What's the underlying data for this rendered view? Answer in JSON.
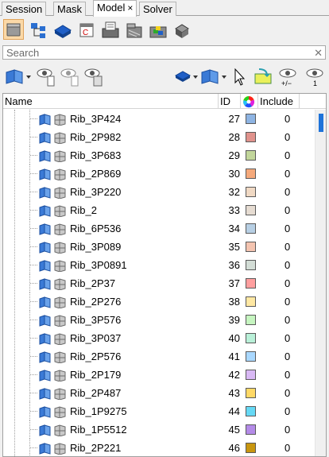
{
  "tabs": [
    {
      "label": "Session",
      "active": false
    },
    {
      "label": "Mask",
      "active": false
    },
    {
      "label": "Model",
      "active": true,
      "close": "×"
    },
    {
      "label": "Solver",
      "active": false
    }
  ],
  "toolbar1": {
    "icons": [
      "component-view-icon",
      "hierarchy-view-icon",
      "part-assembly-icon",
      "calendar-reset-icon",
      "include-file-icon",
      "material-icon",
      "property-icon",
      "solid-blocks-icon",
      "connector-icon"
    ]
  },
  "search": {
    "placeholder": "Search",
    "value": ""
  },
  "toolbar2": {
    "icons": [
      "entity-display-icon",
      "dropdown-arrow-icon",
      "show-icon",
      "hide-icon",
      "isolate-icon",
      "component-color-icon",
      "part-visibility-icon",
      "pointer-icon",
      "export-icon",
      "reverse-visibility-icon",
      "show-one-icon"
    ]
  },
  "table": {
    "columns": {
      "name": "Name",
      "id": "ID",
      "include": "Include"
    },
    "rows": [
      {
        "name": "Rib_3P424",
        "id": "27",
        "color": "#8eb4e3",
        "include": "0"
      },
      {
        "name": "Rib_2P982",
        "id": "28",
        "color": "#e0928c",
        "include": "0"
      },
      {
        "name": "Rib_3P683",
        "id": "29",
        "color": "#c2d69b",
        "include": "0"
      },
      {
        "name": "Rib_2P869",
        "id": "30",
        "color": "#f5a97b",
        "include": "0"
      },
      {
        "name": "Rib_3P220",
        "id": "32",
        "color": "#f0d9c4",
        "include": "0"
      },
      {
        "name": "Rib_2",
        "id": "33",
        "color": "#e6dcd2",
        "include": "0"
      },
      {
        "name": "Rib_6P536",
        "id": "34",
        "color": "#b7cfe4",
        "include": "0"
      },
      {
        "name": "Rib_3P089",
        "id": "35",
        "color": "#f4c4b0",
        "include": "0"
      },
      {
        "name": "Rib_3P0891",
        "id": "36",
        "color": "#d3ddd6",
        "include": "0"
      },
      {
        "name": "Rib_2P37",
        "id": "37",
        "color": "#ff9f9f",
        "include": "0"
      },
      {
        "name": "Rib_2P276",
        "id": "38",
        "color": "#ffe8a3",
        "include": "0"
      },
      {
        "name": "Rib_3P576",
        "id": "39",
        "color": "#c6f5c0",
        "include": "0"
      },
      {
        "name": "Rib_3P037",
        "id": "40",
        "color": "#b9f0d8",
        "include": "0"
      },
      {
        "name": "Rib_2P576",
        "id": "41",
        "color": "#a9d8ff",
        "include": "0"
      },
      {
        "name": "Rib_2P179",
        "id": "42",
        "color": "#d9b9f5",
        "include": "0"
      },
      {
        "name": "Rib_2P487",
        "id": "43",
        "color": "#ffd966",
        "include": "0"
      },
      {
        "name": "Rib_1P9275",
        "id": "44",
        "color": "#66d9f5",
        "include": "0"
      },
      {
        "name": "Rib_1P5512",
        "id": "45",
        "color": "#b48be8",
        "include": "0"
      },
      {
        "name": "Rib_2P221",
        "id": "46",
        "color": "#c8960f",
        "include": "0"
      }
    ]
  }
}
